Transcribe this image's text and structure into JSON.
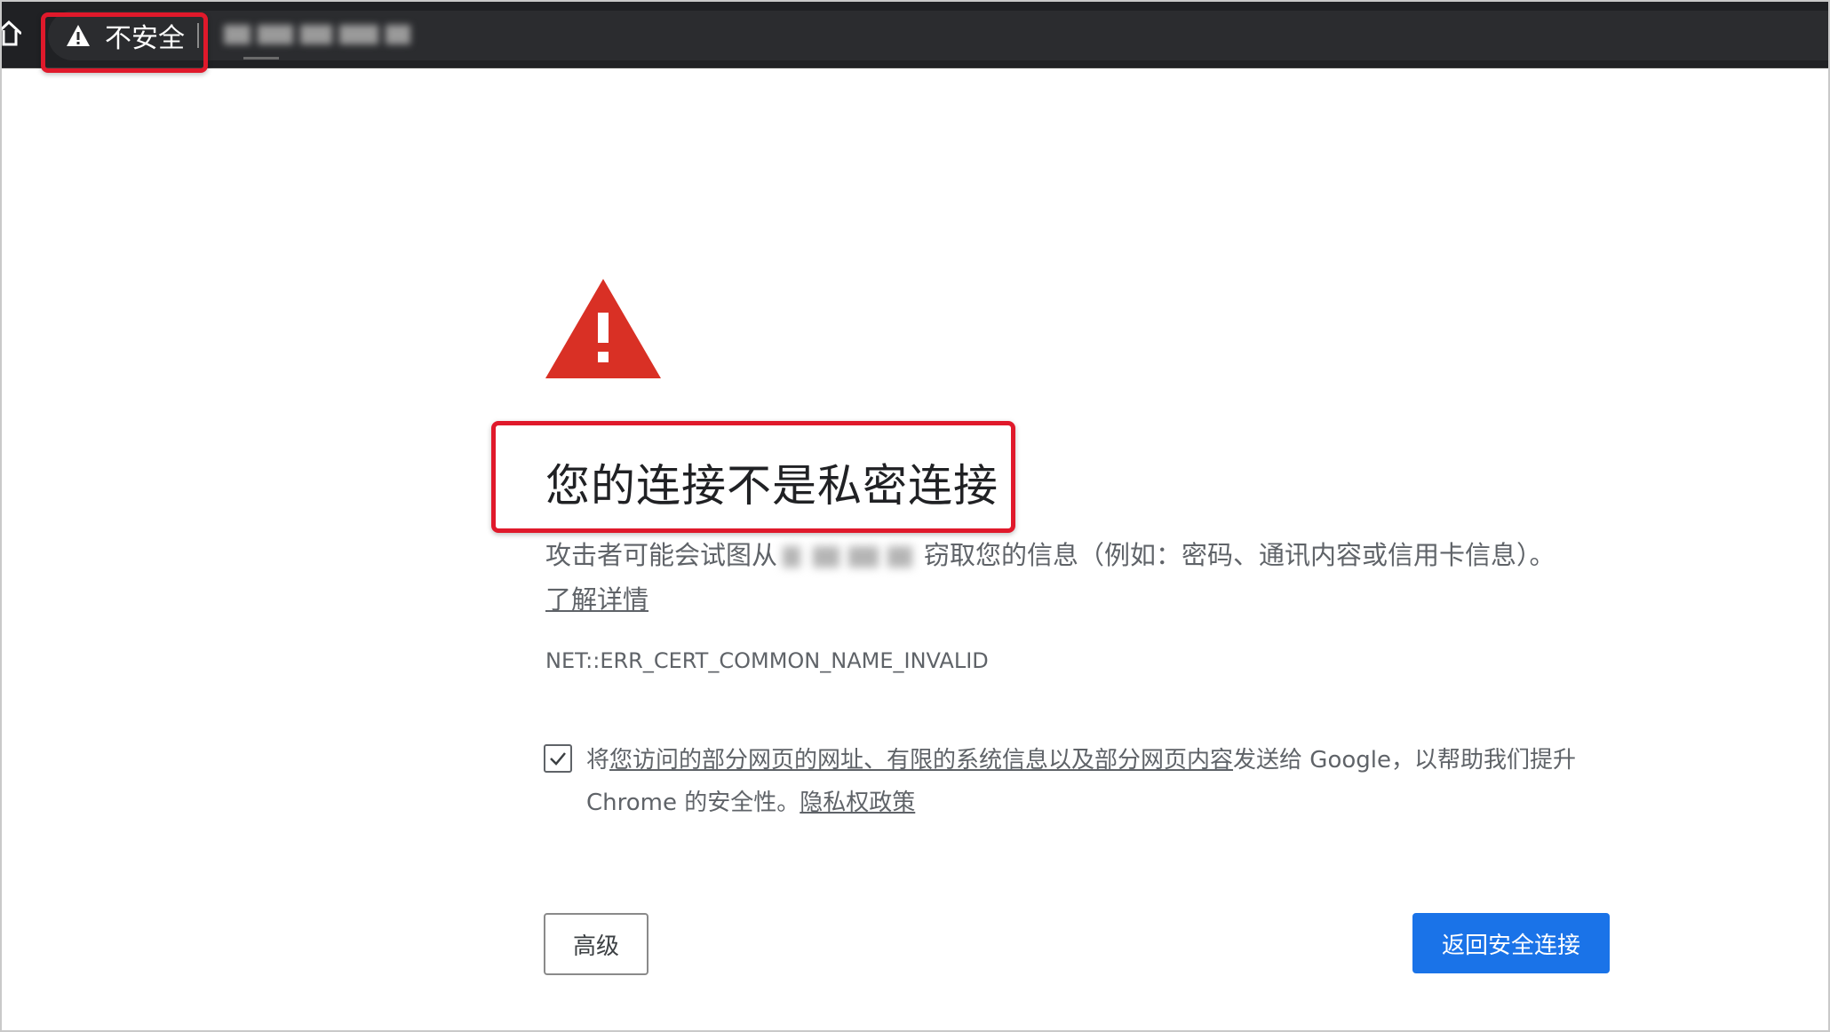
{
  "toolbar": {
    "security_label": "不安全"
  },
  "interstitial": {
    "heading": "您的连接不是私密连接",
    "description_prefix": "攻击者可能会试图从",
    "description_suffix": "窃取您的信息（例如：密码、通讯内容或信用卡信息）。",
    "learn_more_link": "了解详情",
    "error_code": "NET::ERR_CERT_COMMON_NAME_INVALID",
    "optin": {
      "checked": true,
      "text_prefix": "将",
      "link_text": "您访问的部分网页的网址、有限的系统信息以及部分网页内容",
      "text_middle": "发送给 Google，以帮助我们提升 Chrome 的安全性。",
      "privacy_link": "隐私权政策"
    },
    "advanced_button": "高级",
    "back_button": "返回安全连接"
  },
  "colors": {
    "highlight_box": "#e0192b",
    "warning_red": "#d93025",
    "primary_button": "#1a73e8",
    "toolbar_bg": "#202124"
  }
}
